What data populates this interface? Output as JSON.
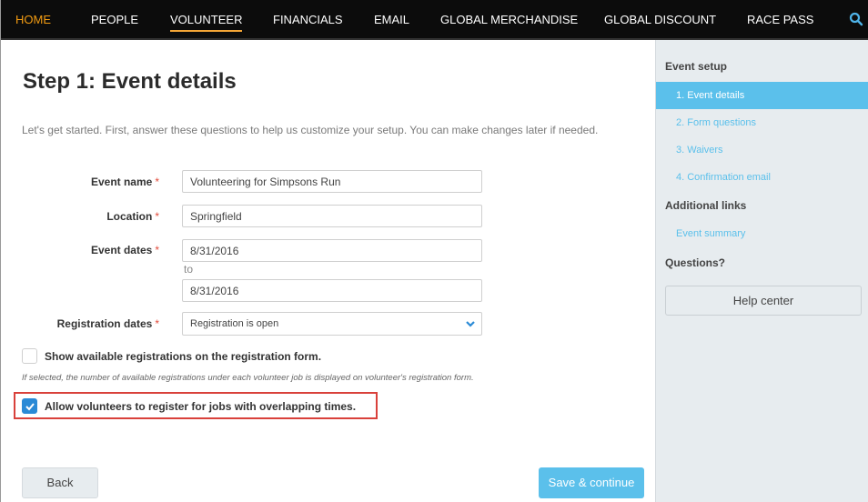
{
  "nav": {
    "items": [
      "HOME",
      "PEOPLE",
      "VOLUNTEER",
      "FINANCIALS",
      "EMAIL",
      "GLOBAL MERCHANDISE",
      "GLOBAL DISCOUNT",
      "RACE PASS"
    ],
    "active": "HOME",
    "current_section": "VOLUNTEER",
    "search_icon": "search-icon"
  },
  "page": {
    "title": "Step 1: Event details",
    "intro": "Let's get started. First, answer these questions to help us customize your setup. You can make changes later if needed."
  },
  "form": {
    "event_name": {
      "label": "Event name",
      "required_mark": "*",
      "value": "Volunteering for Simpsons Run"
    },
    "location": {
      "label": "Location",
      "required_mark": "*",
      "value": "Springfield"
    },
    "event_dates": {
      "label": "Event dates",
      "required_mark": "*",
      "start": "8/31/2016",
      "to": "to",
      "end": "8/31/2016"
    },
    "registration_dates": {
      "label": "Registration dates",
      "required_mark": "*",
      "selected": "Registration is open"
    },
    "show_available": {
      "label": "Show available registrations on the registration form.",
      "checked": false
    },
    "hint": "If selected, the number of available registrations under each volunteer job is displayed on volunteer's registration form.",
    "allow_overlap": {
      "label": "Allow volunteers to register for jobs with overlapping times.",
      "checked": true
    }
  },
  "buttons": {
    "back": "Back",
    "save": "Save & continue"
  },
  "sidebar": {
    "setup_heading": "Event setup",
    "steps": [
      "1. Event details",
      "2. Form questions",
      "3. Waivers",
      "4. Confirmation email"
    ],
    "active_step": "1. Event details",
    "links_heading": "Additional links",
    "links": [
      "Event summary"
    ],
    "questions_heading": "Questions?",
    "help_button": "Help center"
  },
  "colors": {
    "accent": "#5bc0eb",
    "nav_bg": "#0c0c0c",
    "home_active": "#f39c12",
    "required": "#e24b3b",
    "highlight": "#d9413b",
    "checkbox": "#2a8ad6"
  }
}
